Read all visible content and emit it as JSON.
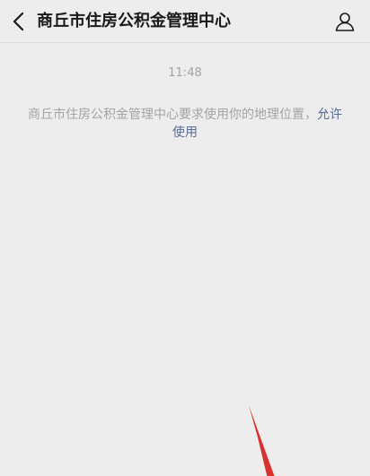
{
  "header": {
    "title": "商丘市住房公积金管理中心",
    "back_icon": "chevron-left-icon",
    "profile_icon": "person-icon"
  },
  "chat": {
    "timestamp": "11:48",
    "notice_text": "商丘市住房公积金管理中心要求使用你的地理位置，",
    "notice_link": "允许使用"
  },
  "colors": {
    "background": "#ededed",
    "link": "#576b95",
    "annotation_arrow": "#d93030"
  }
}
